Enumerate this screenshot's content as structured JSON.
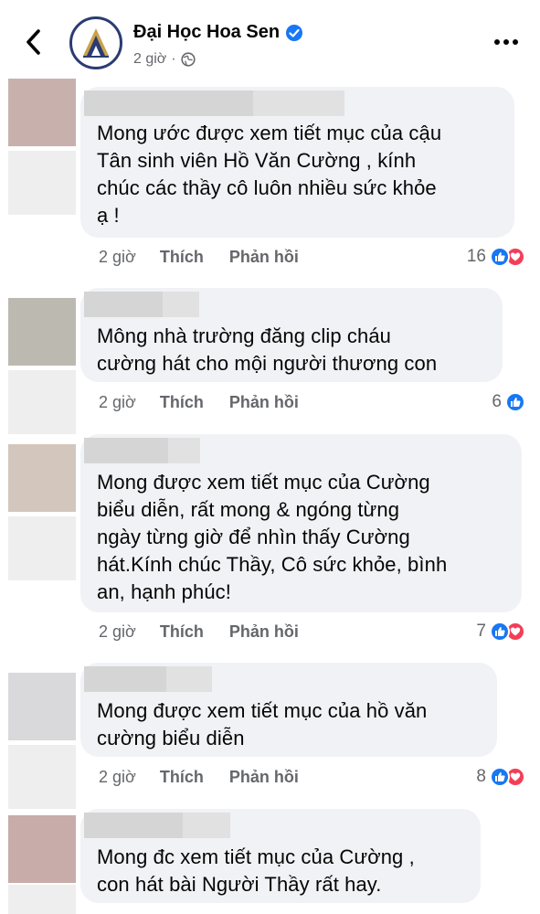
{
  "header": {
    "page_name": "Đại Học Hoa Sen",
    "time": "2 giờ",
    "separator": "·",
    "back_icon": "back-chevron-icon",
    "verified_icon": "verified-badge-icon",
    "privacy_icon": "globe-icon",
    "more_icon": "more-dots-icon"
  },
  "comments": [
    {
      "lines": [
        "Mong ước được xem tiết mục của cậu",
        "Tân sinh viên Hồ Văn Cường , kính",
        "chúc các thầy cô luôn nhiều sức khỏe",
        "ạ !"
      ],
      "time": "2 giờ",
      "like": "Thích",
      "reply": "Phản hồi",
      "reaction_count": "16",
      "reactions": [
        "like",
        "love"
      ]
    },
    {
      "lines": [
        "Mông nhà trường đăng clip cháu",
        "cường hát cho mội người thương con"
      ],
      "time": "2 giờ",
      "like": "Thích",
      "reply": "Phản hồi",
      "reaction_count": "6",
      "reactions": [
        "like"
      ]
    },
    {
      "lines": [
        "Mong được xem tiết mục của Cường",
        "biểu diễn, rất mong & ngóng từng",
        "ngày từng giờ để nhìn thấy Cường",
        "hát.Kính chúc Thầy, Cô sức khỏe, bình",
        "an, hạnh phúc!"
      ],
      "time": "2 giờ",
      "like": "Thích",
      "reply": "Phản hồi",
      "reaction_count": "7",
      "reactions": [
        "like",
        "love"
      ]
    },
    {
      "lines": [
        "Mong được xem tiết mục của hồ văn",
        "cường biểu diễn"
      ],
      "time": "2 giờ",
      "like": "Thích",
      "reply": "Phản hồi",
      "reaction_count": "8",
      "reactions": [
        "like",
        "love"
      ]
    },
    {
      "lines": [
        "Mong đc xem tiết mục của Cường ,",
        "con hát bài Người Thầy rất hay."
      ]
    }
  ],
  "colors": {
    "like_blue": "#1877f2",
    "love_red": "#f33e58",
    "bubble_gray": "#f0f2f5",
    "meta_gray": "#65676b",
    "logo_navy": "#2c3c72"
  }
}
